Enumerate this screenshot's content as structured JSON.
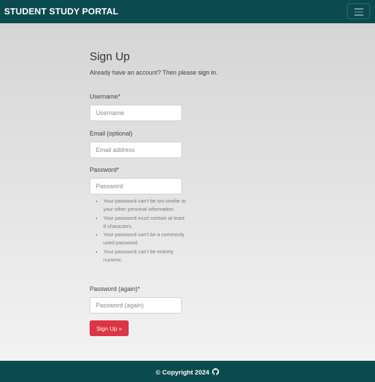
{
  "navbar": {
    "brand": "STUDENT STUDY PORTAL",
    "toggler_icon": "hamburger-menu-icon",
    "background_color": "#0b4b50"
  },
  "form": {
    "title": "Sign Up",
    "subtitle_prefix": "Already have an account? Then please ",
    "subtitle_link": "sign in",
    "subtitle_suffix": ".",
    "username": {
      "label": "Username*",
      "placeholder": "Username",
      "value": ""
    },
    "email": {
      "label": "Email (optional)",
      "placeholder": "Email address",
      "value": ""
    },
    "password": {
      "label": "Password*",
      "placeholder": "Password",
      "value": ""
    },
    "password_help": [
      "Your password can’t be too similar to your other personal information.",
      "Your password must contain at least 8 characters.",
      "Your password can’t be a commonly used password.",
      "Your password can’t be entirely numeric."
    ],
    "password_again": {
      "label": "Password (again)*",
      "placeholder": "Password (again)",
      "value": ""
    },
    "submit_label": "Sign Up »",
    "submit_color": "#dc3545"
  },
  "footer": {
    "text": "© Copyright 2024",
    "icon": "github-icon",
    "background_color": "#0b4b50"
  }
}
